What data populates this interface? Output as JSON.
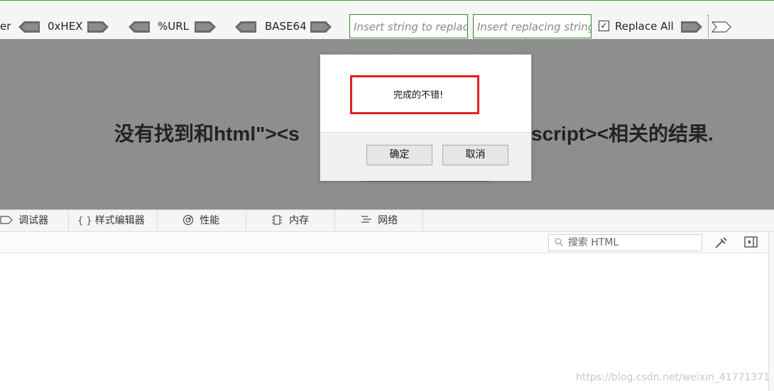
{
  "toolbar": {
    "clipped_label": "er",
    "hex_label": "0xHEX",
    "url_label": "%URL",
    "base64_label": "BASE64",
    "replace_string_placeholder": "Insert string to replace",
    "replacing_string_placeholder": "Insert replacing string",
    "replace_all_label": "Replace All",
    "replace_all_checked": "✓"
  },
  "page": {
    "message_left": "没有找到和html\"><s",
    "message_right": "script><相关的结果."
  },
  "dialog": {
    "message": "完成的不错!",
    "ok_label": "确定",
    "cancel_label": "取消"
  },
  "devtools": {
    "tabs": [
      {
        "icon": "debugger-icon",
        "label": "调试器"
      },
      {
        "icon": "braces-icon",
        "label": "样式编辑器",
        "icon_text": "{ }"
      },
      {
        "icon": "performance-icon",
        "label": "性能"
      },
      {
        "icon": "memory-icon",
        "label": "内存"
      },
      {
        "icon": "network-icon",
        "label": "网络"
      }
    ],
    "search_placeholder": "搜索 HTML"
  },
  "watermark": "https://blog.csdn.net/weixin_41771371",
  "colors": {
    "toolbar_border": "#3a9a3a",
    "dialog_highlight": "#e02020",
    "overlay": "#8e8e8e"
  }
}
